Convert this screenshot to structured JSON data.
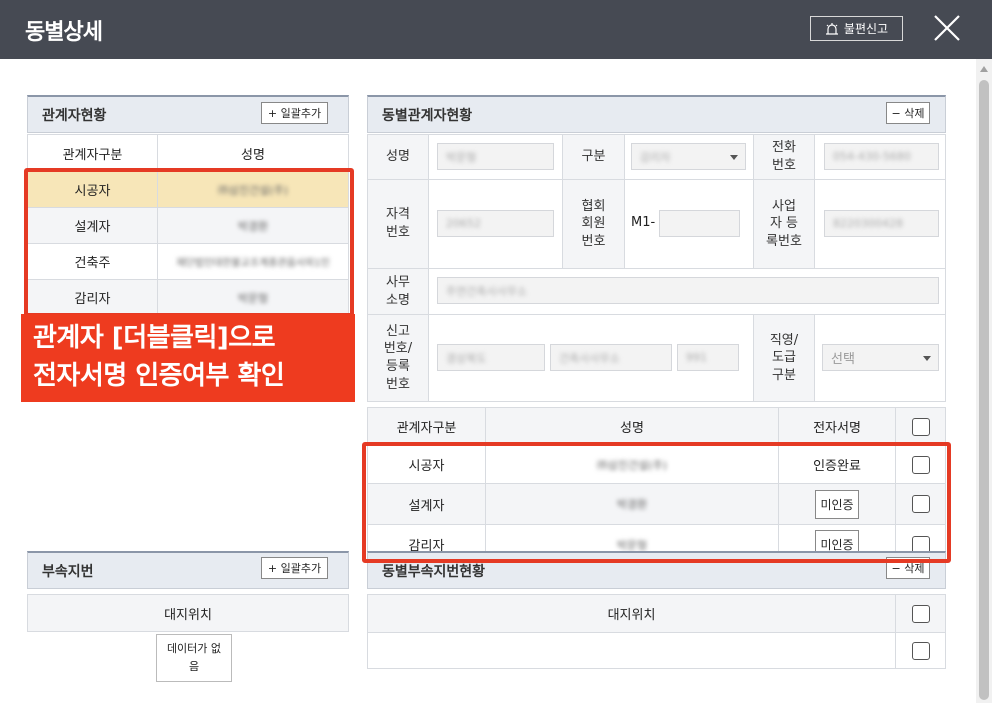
{
  "window": {
    "title": "동별상세",
    "report_label": "불편신고"
  },
  "left_panel": {
    "title": "관계자현황",
    "add_button": "+ 일괄추가",
    "columns": [
      "관계자구분",
      "성명"
    ],
    "rows": [
      {
        "type": "시공자",
        "name": "㈜삼진건설(주)",
        "highlighted": true
      },
      {
        "type": "설계자",
        "name": "박경환"
      },
      {
        "type": "건축주",
        "name": "재단법인대한불교조계종관음사외1인"
      },
      {
        "type": "감리자",
        "name": "박문형"
      }
    ]
  },
  "callout": {
    "line1": "관계자 [더블클릭]으로",
    "line2": "전자서명 인증여부 확인",
    "color": "#ee3b1f"
  },
  "right_panel": {
    "title": "동별관계자현황",
    "delete_button": "− 삭제",
    "labels": {
      "name": "성명",
      "category": "구분",
      "phone": "전화\n번호",
      "license": "자격\n번호",
      "assoc": "협회\n회원\n번호",
      "bizno": "사업\n자 등\n록번호",
      "office": "사무\n소명",
      "report": "신고\n번호/\n등록\n번호",
      "direct": "직영/\n도급\n구분"
    },
    "values": {
      "name": "박문형",
      "category": "감리자",
      "phone": "054-430-5680",
      "license": "20652",
      "assoc_prefix": "M1-",
      "bizno": "8220300428",
      "office": "주연건축사사무소",
      "report1": "경상북도",
      "report2": "건축사사무소",
      "report3": "991",
      "direct_placeholder": "선택"
    }
  },
  "sign_table": {
    "columns": [
      "관계자구분",
      "성명",
      "전자서명"
    ],
    "rows": [
      {
        "type": "시공자",
        "name": "㈜삼진건설(주)",
        "status": "인증완료",
        "is_button": false
      },
      {
        "type": "설계자",
        "name": "박경환",
        "status": "미인증",
        "is_button": true
      },
      {
        "type": "감리자",
        "name": "박문형",
        "status": "미인증",
        "is_button": true
      }
    ]
  },
  "sub_lot_panel": {
    "title": "부속지번",
    "add_button": "+ 일괄추가",
    "column": "대지위치",
    "empty_text": "데이터가 없음"
  },
  "sub_lot_status_panel": {
    "title": "동별부속지번현황",
    "delete_button": "− 삭제",
    "column": "대지위치"
  }
}
